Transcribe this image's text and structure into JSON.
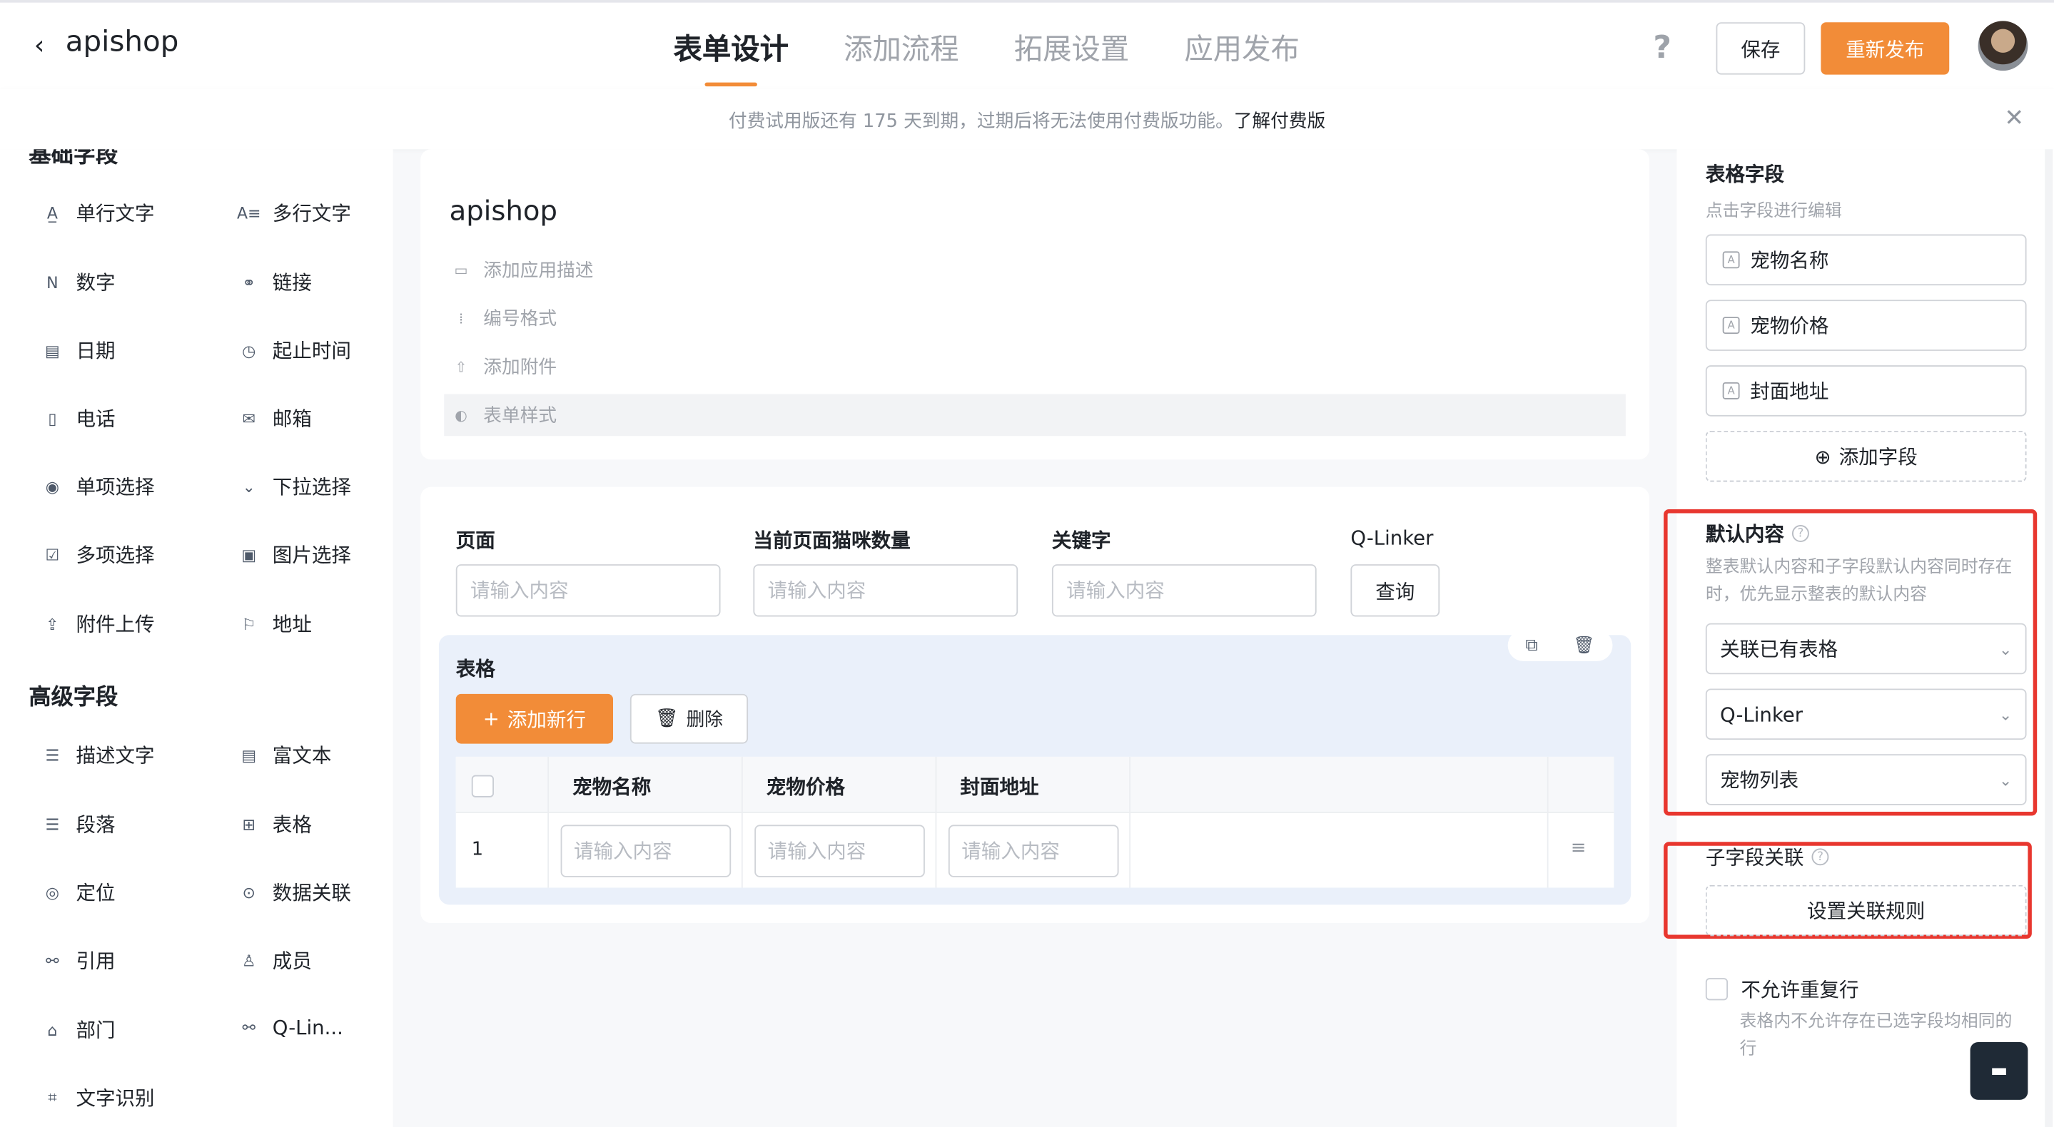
{
  "header": {
    "back_icon": "chevron-left-icon",
    "app_name": "apishop",
    "tabs": [
      {
        "label": "表单设计",
        "active": true
      },
      {
        "label": "添加流程",
        "active": false
      },
      {
        "label": "拓展设置",
        "active": false
      },
      {
        "label": "应用发布",
        "active": false
      }
    ],
    "help_label": "?",
    "save_label": "保存",
    "publish_label": "重新发布",
    "accent_color": "#f28c38"
  },
  "banner": {
    "text": "付费试用版还有 175 天到期，过期后将无法使用付费版功能。",
    "link": "了解付费版",
    "close_label": "✕"
  },
  "left_panel": {
    "basic_title": "基础字段",
    "basic_fields": [
      {
        "label": "单行文字",
        "icon": "single-line-text-icon",
        "glyph": "A̲"
      },
      {
        "label": "多行文字",
        "icon": "multi-line-text-icon",
        "glyph": "A≡"
      },
      {
        "label": "数字",
        "icon": "number-icon",
        "glyph": "N"
      },
      {
        "label": "链接",
        "icon": "link-icon",
        "glyph": "🔗"
      },
      {
        "label": "日期",
        "icon": "calendar-icon",
        "glyph": "▤"
      },
      {
        "label": "起止时间",
        "icon": "time-range-icon",
        "glyph": "◷"
      },
      {
        "label": "电话",
        "icon": "phone-icon",
        "glyph": "▯"
      },
      {
        "label": "邮箱",
        "icon": "mail-icon",
        "glyph": "✉"
      },
      {
        "label": "单项选择",
        "icon": "radio-icon",
        "glyph": "◉"
      },
      {
        "label": "下拉选择",
        "icon": "dropdown-icon",
        "glyph": "⌄"
      },
      {
        "label": "多项选择",
        "icon": "checkbox-icon",
        "glyph": "☑"
      },
      {
        "label": "图片选择",
        "icon": "image-icon",
        "glyph": "▣"
      },
      {
        "label": "附件上传",
        "icon": "upload-icon",
        "glyph": "⇪"
      },
      {
        "label": "地址",
        "icon": "address-icon",
        "glyph": "⚐"
      }
    ],
    "advanced_title": "高级字段",
    "advanced_fields": [
      {
        "label": "描述文字",
        "icon": "description-icon",
        "glyph": "☰"
      },
      {
        "label": "富文本",
        "icon": "rich-text-icon",
        "glyph": "▤"
      },
      {
        "label": "段落",
        "icon": "paragraph-icon",
        "glyph": "☰"
      },
      {
        "label": "表格",
        "icon": "table-icon",
        "glyph": "⊞"
      },
      {
        "label": "定位",
        "icon": "location-icon",
        "glyph": "◎"
      },
      {
        "label": "数据关联",
        "icon": "data-link-icon",
        "glyph": "⊙"
      },
      {
        "label": "引用",
        "icon": "reference-icon",
        "glyph": "⚯"
      },
      {
        "label": "成员",
        "icon": "member-icon",
        "glyph": "👤"
      },
      {
        "label": "部门",
        "icon": "department-icon",
        "glyph": "⌂"
      },
      {
        "label": "Q-Lin...",
        "icon": "q-linker-icon",
        "glyph": "⚯"
      },
      {
        "label": "文字识别",
        "icon": "ocr-icon",
        "glyph": "⌗"
      }
    ]
  },
  "form_card": {
    "title": "apishop",
    "items": [
      {
        "label": "添加应用描述",
        "icon": "comment-icon",
        "glyph": "▭"
      },
      {
        "label": "编号格式",
        "icon": "numbering-icon",
        "glyph": "⁞"
      },
      {
        "label": "添加附件",
        "icon": "upload-icon",
        "glyph": "⇧"
      },
      {
        "label": "表单样式",
        "icon": "palette-icon",
        "glyph": "◐"
      }
    ]
  },
  "form_fields": {
    "fields": [
      {
        "label": "页面",
        "placeholder": "请输入内容"
      },
      {
        "label": "当前页面猫咪数量",
        "placeholder": "请输入内容"
      },
      {
        "label": "关键字",
        "placeholder": "请输入内容"
      }
    ],
    "qlinker_label": "Q-Linker",
    "query_label": "查询"
  },
  "table_block": {
    "title": "表格",
    "copy_icon": "⧉",
    "delete_icon": "🗑",
    "add_row_label": "添加新行",
    "add_row_glyph": "+",
    "delete_label": "删除",
    "delete_glyph": "🗑",
    "columns": [
      "宠物名称",
      "宠物价格",
      "封面地址"
    ],
    "row_number": "1",
    "cell_placeholder": "请输入内容",
    "row_op_glyph": "≡"
  },
  "right_panel": {
    "title": "表格字段",
    "subtitle": "点击字段进行编辑",
    "fields": [
      "宠物名称",
      "宠物价格",
      "封面地址"
    ],
    "field_glyph": "A",
    "add_field_label": "添加字段",
    "add_field_glyph": "⊕",
    "default_content_label": "默认内容",
    "default_content_desc": "整表默认内容和子字段默认内容同时存在时，优先显示整表的默认内容",
    "selects": [
      "关联已有表格",
      "Q-Linker",
      "宠物列表"
    ],
    "sub_link_label": "子字段关联",
    "rule_label": "设置关联规则",
    "no_dup_label": "不允许重复行",
    "no_dup_desc": "表格内不允许存在已选字段均相同的行",
    "help_glyph": "?",
    "chevron": "⌄",
    "chat_glyph": "💬"
  }
}
